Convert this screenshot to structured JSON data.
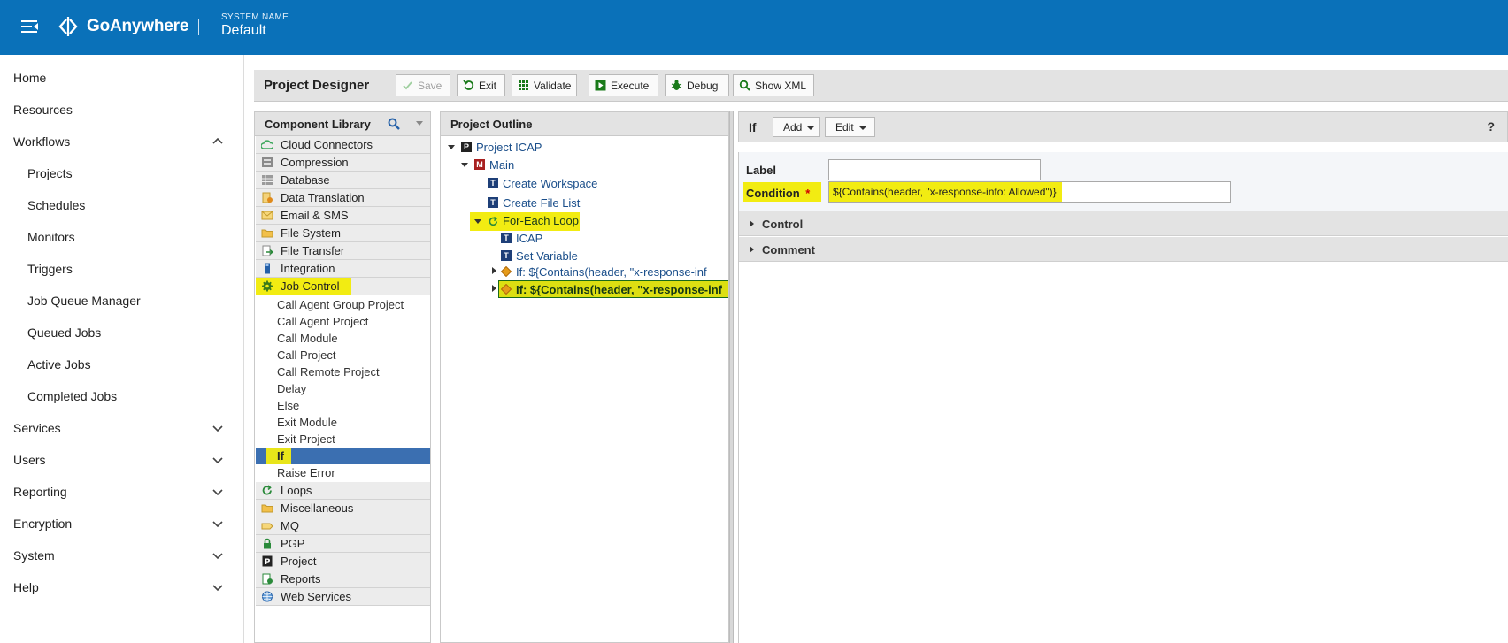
{
  "header": {
    "brand": "GoAnywhere",
    "system_name_label": "SYSTEM NAME",
    "system_name": "Default",
    "bar_color": "#0a71b9"
  },
  "nav": {
    "items": [
      {
        "label": "Home"
      },
      {
        "label": "Resources"
      },
      {
        "label": "Workflows",
        "expanded": true
      },
      {
        "label": "Projects"
      },
      {
        "label": "Schedules"
      },
      {
        "label": "Monitors"
      },
      {
        "label": "Triggers"
      },
      {
        "label": "Job Queue Manager"
      },
      {
        "label": "Queued Jobs"
      },
      {
        "label": "Active Jobs"
      },
      {
        "label": "Completed Jobs"
      },
      {
        "label": "Services"
      },
      {
        "label": "Users"
      },
      {
        "label": "Reporting"
      },
      {
        "label": "Encryption"
      },
      {
        "label": "System"
      },
      {
        "label": "Help"
      }
    ]
  },
  "toolbar": {
    "title": "Project Designer",
    "save": "Save",
    "exit": "Exit",
    "validate": "Validate",
    "execute": "Execute",
    "debug": "Debug",
    "show_xml": "Show XML"
  },
  "library": {
    "title": "Component Library",
    "categories": [
      {
        "label": "Cloud Connectors",
        "icon": "cloud-icon"
      },
      {
        "label": "Compression",
        "icon": "compression-icon"
      },
      {
        "label": "Database",
        "icon": "database-icon"
      },
      {
        "label": "Data Translation",
        "icon": "translation-icon"
      },
      {
        "label": "Email & SMS",
        "icon": "email-icon"
      },
      {
        "label": "File System",
        "icon": "folder-icon"
      },
      {
        "label": "File Transfer",
        "icon": "file-transfer-icon"
      },
      {
        "label": "Integration",
        "icon": "integration-icon"
      },
      {
        "label": "Job Control",
        "icon": "gear-icon"
      }
    ],
    "job_control_items": [
      "Call Agent Group Project",
      "Call Agent Project",
      "Call Module",
      "Call Project",
      "Call Remote Project",
      "Delay",
      "Else",
      "Exit Module",
      "Exit Project",
      "If",
      "Raise Error"
    ],
    "more_categories": [
      {
        "label": "Loops",
        "icon": "loop-icon"
      },
      {
        "label": "Miscellaneous",
        "icon": "folder-icon"
      },
      {
        "label": "MQ",
        "icon": "mq-icon"
      },
      {
        "label": "PGP",
        "icon": "lock-icon"
      },
      {
        "label": "Project",
        "icon": "project-icon"
      },
      {
        "label": "Reports",
        "icon": "report-icon"
      },
      {
        "label": "Web Services",
        "icon": "globe-icon"
      }
    ]
  },
  "outline": {
    "title": "Project Outline",
    "nodes": [
      "Project ICAP",
      "Main",
      "Create Workspace",
      "Create File List",
      "For-Each Loop",
      "ICAP",
      "Set Variable",
      "If: ${Contains(header, \"x-response-inf",
      "If: ${Contains(header, \"x-response-inf"
    ]
  },
  "properties": {
    "title": "If",
    "add": "Add",
    "edit": "Edit",
    "help": "?",
    "label_field": "Label",
    "label_value": "",
    "condition_field": "Condition",
    "required_mark": "*",
    "condition_value": "${Contains(header, \"x-response-info: Allowed\")}",
    "sections": [
      "Control",
      "Comment"
    ]
  },
  "colors": {
    "highlight": "#f2ec12",
    "selected": "#3b6fb1",
    "link": "#1a4e8a",
    "required": "#d00000"
  }
}
